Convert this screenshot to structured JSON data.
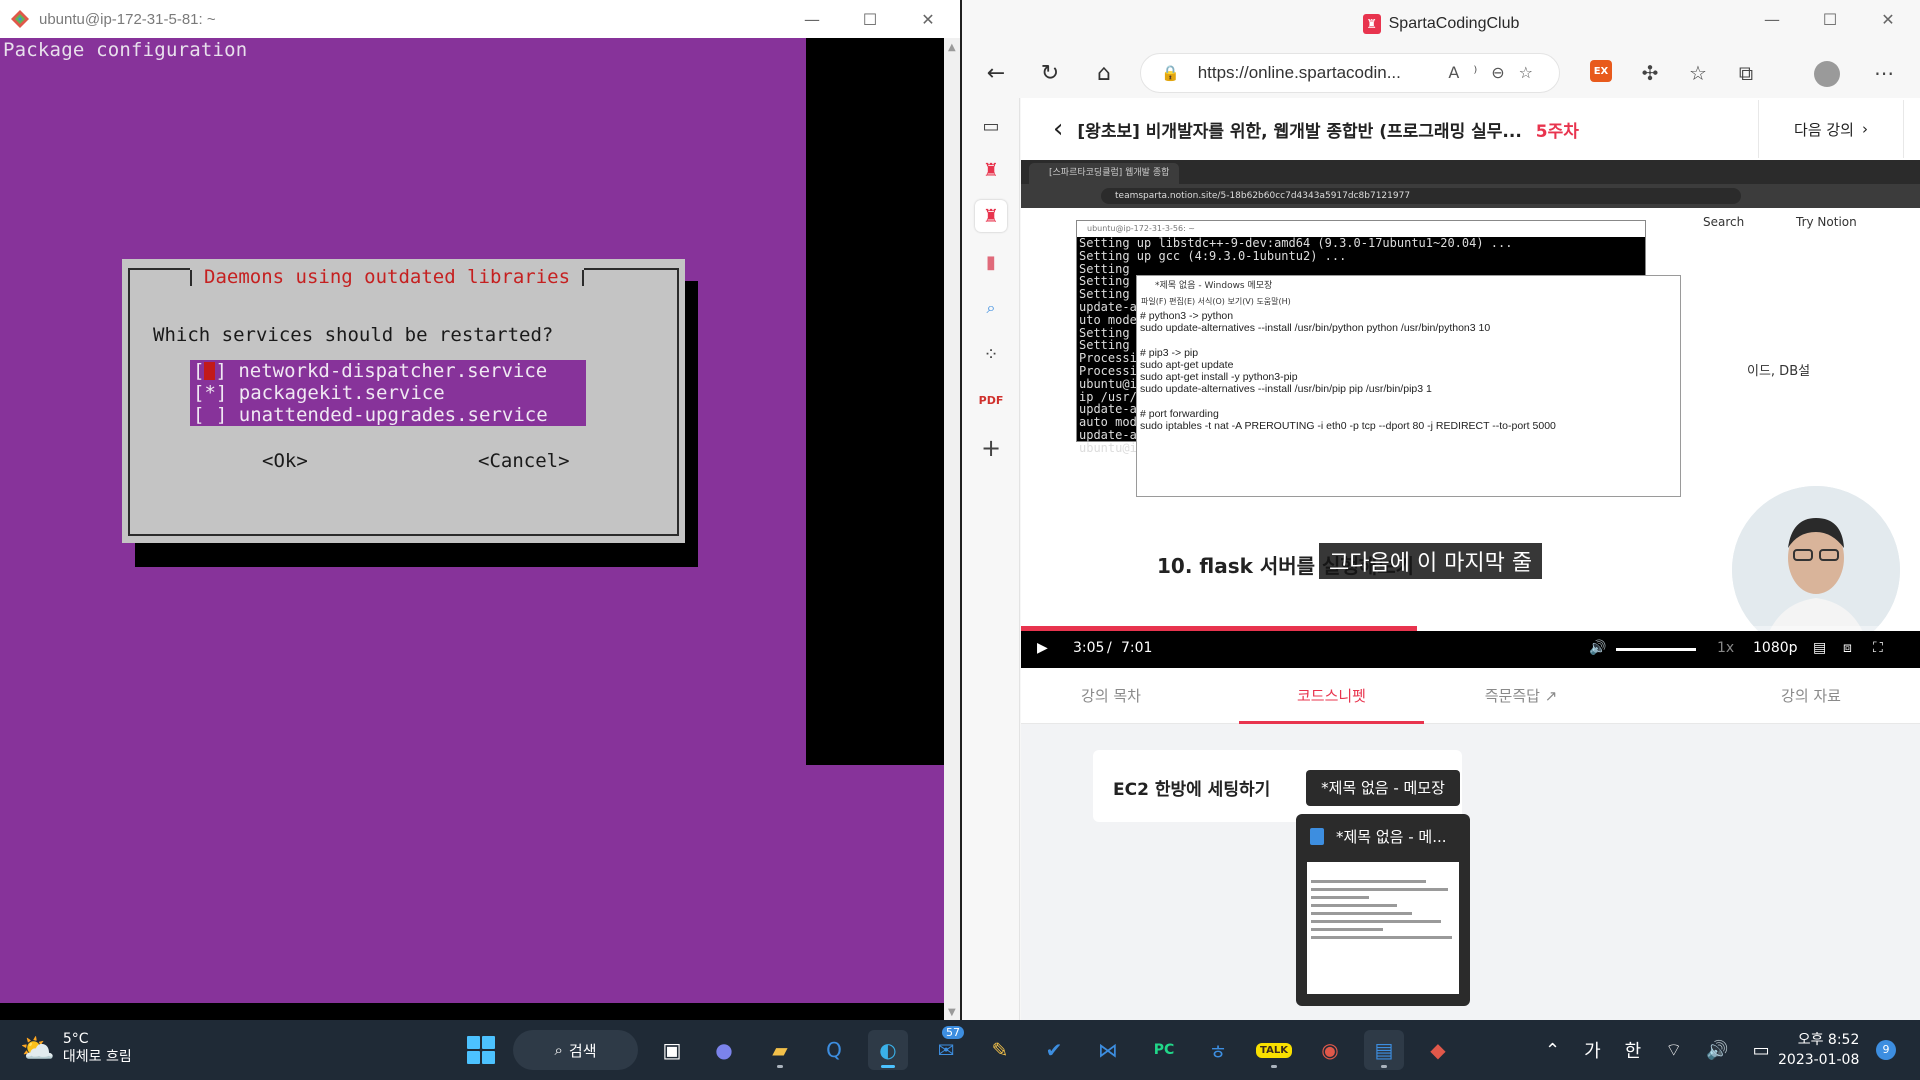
{
  "terminal": {
    "window_title": "ubuntu@ip-172-31-5-81: ~",
    "header": "Package configuration",
    "dialog": {
      "title": "Daemons using outdated libraries",
      "question": "Which services should be restarted?",
      "services": [
        {
          "mark": "[ ]",
          "label": "networkd-dispatcher.service"
        },
        {
          "mark": "[*]",
          "label": "packagekit.service"
        },
        {
          "mark": "[ ]",
          "label": "unattended-upgrades.service"
        }
      ],
      "ok_label": "<Ok>",
      "cancel_label": "<Cancel>"
    }
  },
  "browser": {
    "window_title": "SpartaCodingClub",
    "url": "https://online.spartacodin...",
    "course_title": "[왕초보] 비개발자를 위한, 웹개발 종합반 (프로그래밍 실무...",
    "course_week": "5주차",
    "next_lesson": "다음 강의",
    "video": {
      "tab_title": "[스파르타코딩클럽] 웹개발 종합",
      "url": "teamsparta.notion.site/5-18b62b60cc7d4343a5917dc8b7121977",
      "search": "Search",
      "try_notion": "Try Notion",
      "term_title": "ubuntu@ip-172-31-3-56: ~",
      "term_lines": "Setting up libstdc++-9-dev:amd64 (9.3.0-17ubuntu1~20.04) ...\nSetting up gcc (4:9.3.0-1ubuntu2) ...\nSetting\nSetting\nSetting\nupdate-a\nuto mode\nSetting\nSetting\nProcessi\nProcessi\nubuntu@i\nip /usr/\nupdate-a\nauto mod\nupdate-a\nubuntu@i",
      "notepad_title": "*제목 없음 - Windows 메모장",
      "notepad_menu": "파일(F)  편집(E)  서식(O)  보기(V)  도움말(H)",
      "notepad_text": "# python3 -> python\nsudo update-alternatives --install /usr/bin/python python /usr/bin/python3 10\n\n# pip3 -> pip\nsudo apt-get update\nsudo apt-get install -y python3-pip\nsudo update-alternatives --install /usr/bin/pip pip /usr/bin/pip3 1\n\n# port forwarding\nsudo iptables -t nat -A PREROUTING -i eth0 -p tcp --dport 80 -j REDIRECT --to-port 5000",
      "side_text": "이드, DB설",
      "heading": "10. flask 서버를 실행해보기",
      "caption": "그다음에 이 마지막 줄",
      "time_current": "3:05",
      "time_sep": "/",
      "time_total": "7:01",
      "progress": 0.44,
      "speed": "1x",
      "quality": "1080p"
    },
    "lesson_tabs": [
      "강의 목차",
      "코드스니펫",
      "즉문즉답",
      "강의 자료"
    ],
    "active_tab": 1,
    "snippet_title": "EC2 한방에 세팅하기"
  },
  "taskbar_popup": {
    "tooltip": "*제목 없음 - 메모장",
    "preview_title": "*제목 없음 - 메..."
  },
  "taskbar": {
    "weather_temp": "5°C",
    "weather_desc": "대체로 흐림",
    "search_label": "검색",
    "mail_badge": "57",
    "ime_lang": "가",
    "ime_mode": "한",
    "time": "오후 8:52",
    "date": "2023-01-08",
    "notifications": "9"
  },
  "colors": {
    "terminal_bg": "#87339a",
    "dialog_bg": "#c4c4c4",
    "dialog_title": "#c52020",
    "accent": "#e8344e"
  }
}
